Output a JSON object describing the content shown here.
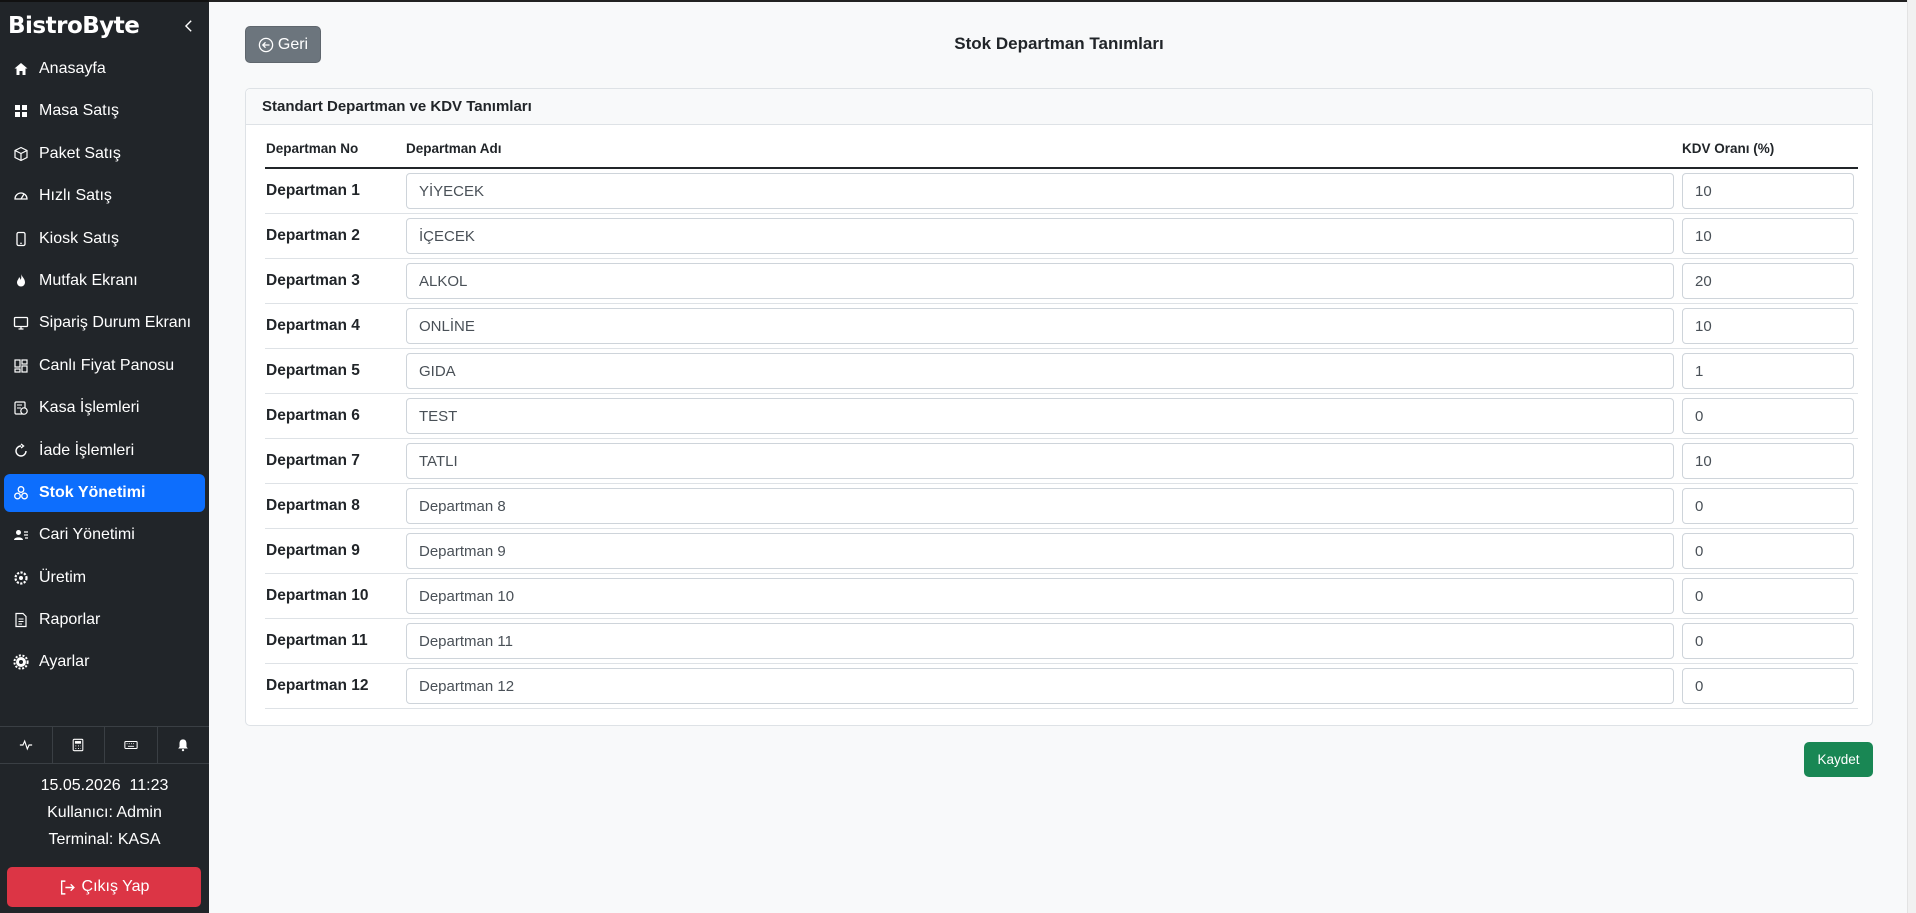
{
  "sidebar": {
    "brand": "BistroByte",
    "items": [
      {
        "label": "Anasayfa",
        "icon": "home-icon",
        "active": false
      },
      {
        "label": "Masa Satış",
        "icon": "grid-icon",
        "active": false
      },
      {
        "label": "Paket Satış",
        "icon": "box-icon",
        "active": false
      },
      {
        "label": "Hızlı Satış",
        "icon": "speedometer-icon",
        "active": false
      },
      {
        "label": "Kiosk Satış",
        "icon": "tablet-icon",
        "active": false
      },
      {
        "label": "Mutfak Ekranı",
        "icon": "fire-icon",
        "active": false
      },
      {
        "label": "Sipariş Durum Ekranı",
        "icon": "monitor-icon",
        "active": false
      },
      {
        "label": "Canlı Fiyat Panosu",
        "icon": "dashboard-icon",
        "active": false
      },
      {
        "label": "Kasa İşlemleri",
        "icon": "cash-register-icon",
        "active": false
      },
      {
        "label": "İade İşlemleri",
        "icon": "refresh-icon",
        "active": false
      },
      {
        "label": "Stok Yönetimi",
        "icon": "boxes-icon",
        "active": true
      },
      {
        "label": "Cari Yönetimi",
        "icon": "contacts-icon",
        "active": false
      },
      {
        "label": "Üretim",
        "icon": "cog-icon",
        "active": false
      },
      {
        "label": "Raporlar",
        "icon": "report-icon",
        "active": false
      },
      {
        "label": "Ayarlar",
        "icon": "gear-icon",
        "active": false
      }
    ],
    "tools": [
      "activity-icon",
      "calculator-icon",
      "keyboard-icon",
      "bell-icon"
    ],
    "datetime": "15.05.2026  11:23",
    "user": "Kullanıcı: Admin",
    "terminal": "Terminal: KASA",
    "logout_label": "Çıkış Yap"
  },
  "header": {
    "back_label": "Geri",
    "title": "Stok Departman Tanımları"
  },
  "card": {
    "title": "Standart Departman ve KDV Tanımları",
    "columns": [
      "Departman No",
      "Departman Adı",
      "KDV Oranı (%)"
    ],
    "rows": [
      {
        "no": "Departman 1",
        "name": "YİYECEK",
        "kdv": "10"
      },
      {
        "no": "Departman 2",
        "name": "İÇECEK",
        "kdv": "10"
      },
      {
        "no": "Departman 3",
        "name": "ALKOL",
        "kdv": "20"
      },
      {
        "no": "Departman 4",
        "name": "ONLİNE",
        "kdv": "10"
      },
      {
        "no": "Departman 5",
        "name": "GIDA",
        "kdv": "1"
      },
      {
        "no": "Departman 6",
        "name": "TEST",
        "kdv": "0"
      },
      {
        "no": "Departman 7",
        "name": "TATLI",
        "kdv": "10"
      },
      {
        "no": "Departman 8",
        "name": "Departman 8",
        "kdv": "0"
      },
      {
        "no": "Departman 9",
        "name": "Departman 9",
        "kdv": "0"
      },
      {
        "no": "Departman 10",
        "name": "Departman 10",
        "kdv": "0"
      },
      {
        "no": "Departman 11",
        "name": "Departman 11",
        "kdv": "0"
      },
      {
        "no": "Departman 12",
        "name": "Departman 12",
        "kdv": "0"
      }
    ]
  },
  "save_label": "Kaydet",
  "colors": {
    "sidebar_bg": "#212529",
    "active": "#0d6efd",
    "danger": "#dc3545",
    "success": "#198754",
    "secondary": "#6c757d"
  }
}
